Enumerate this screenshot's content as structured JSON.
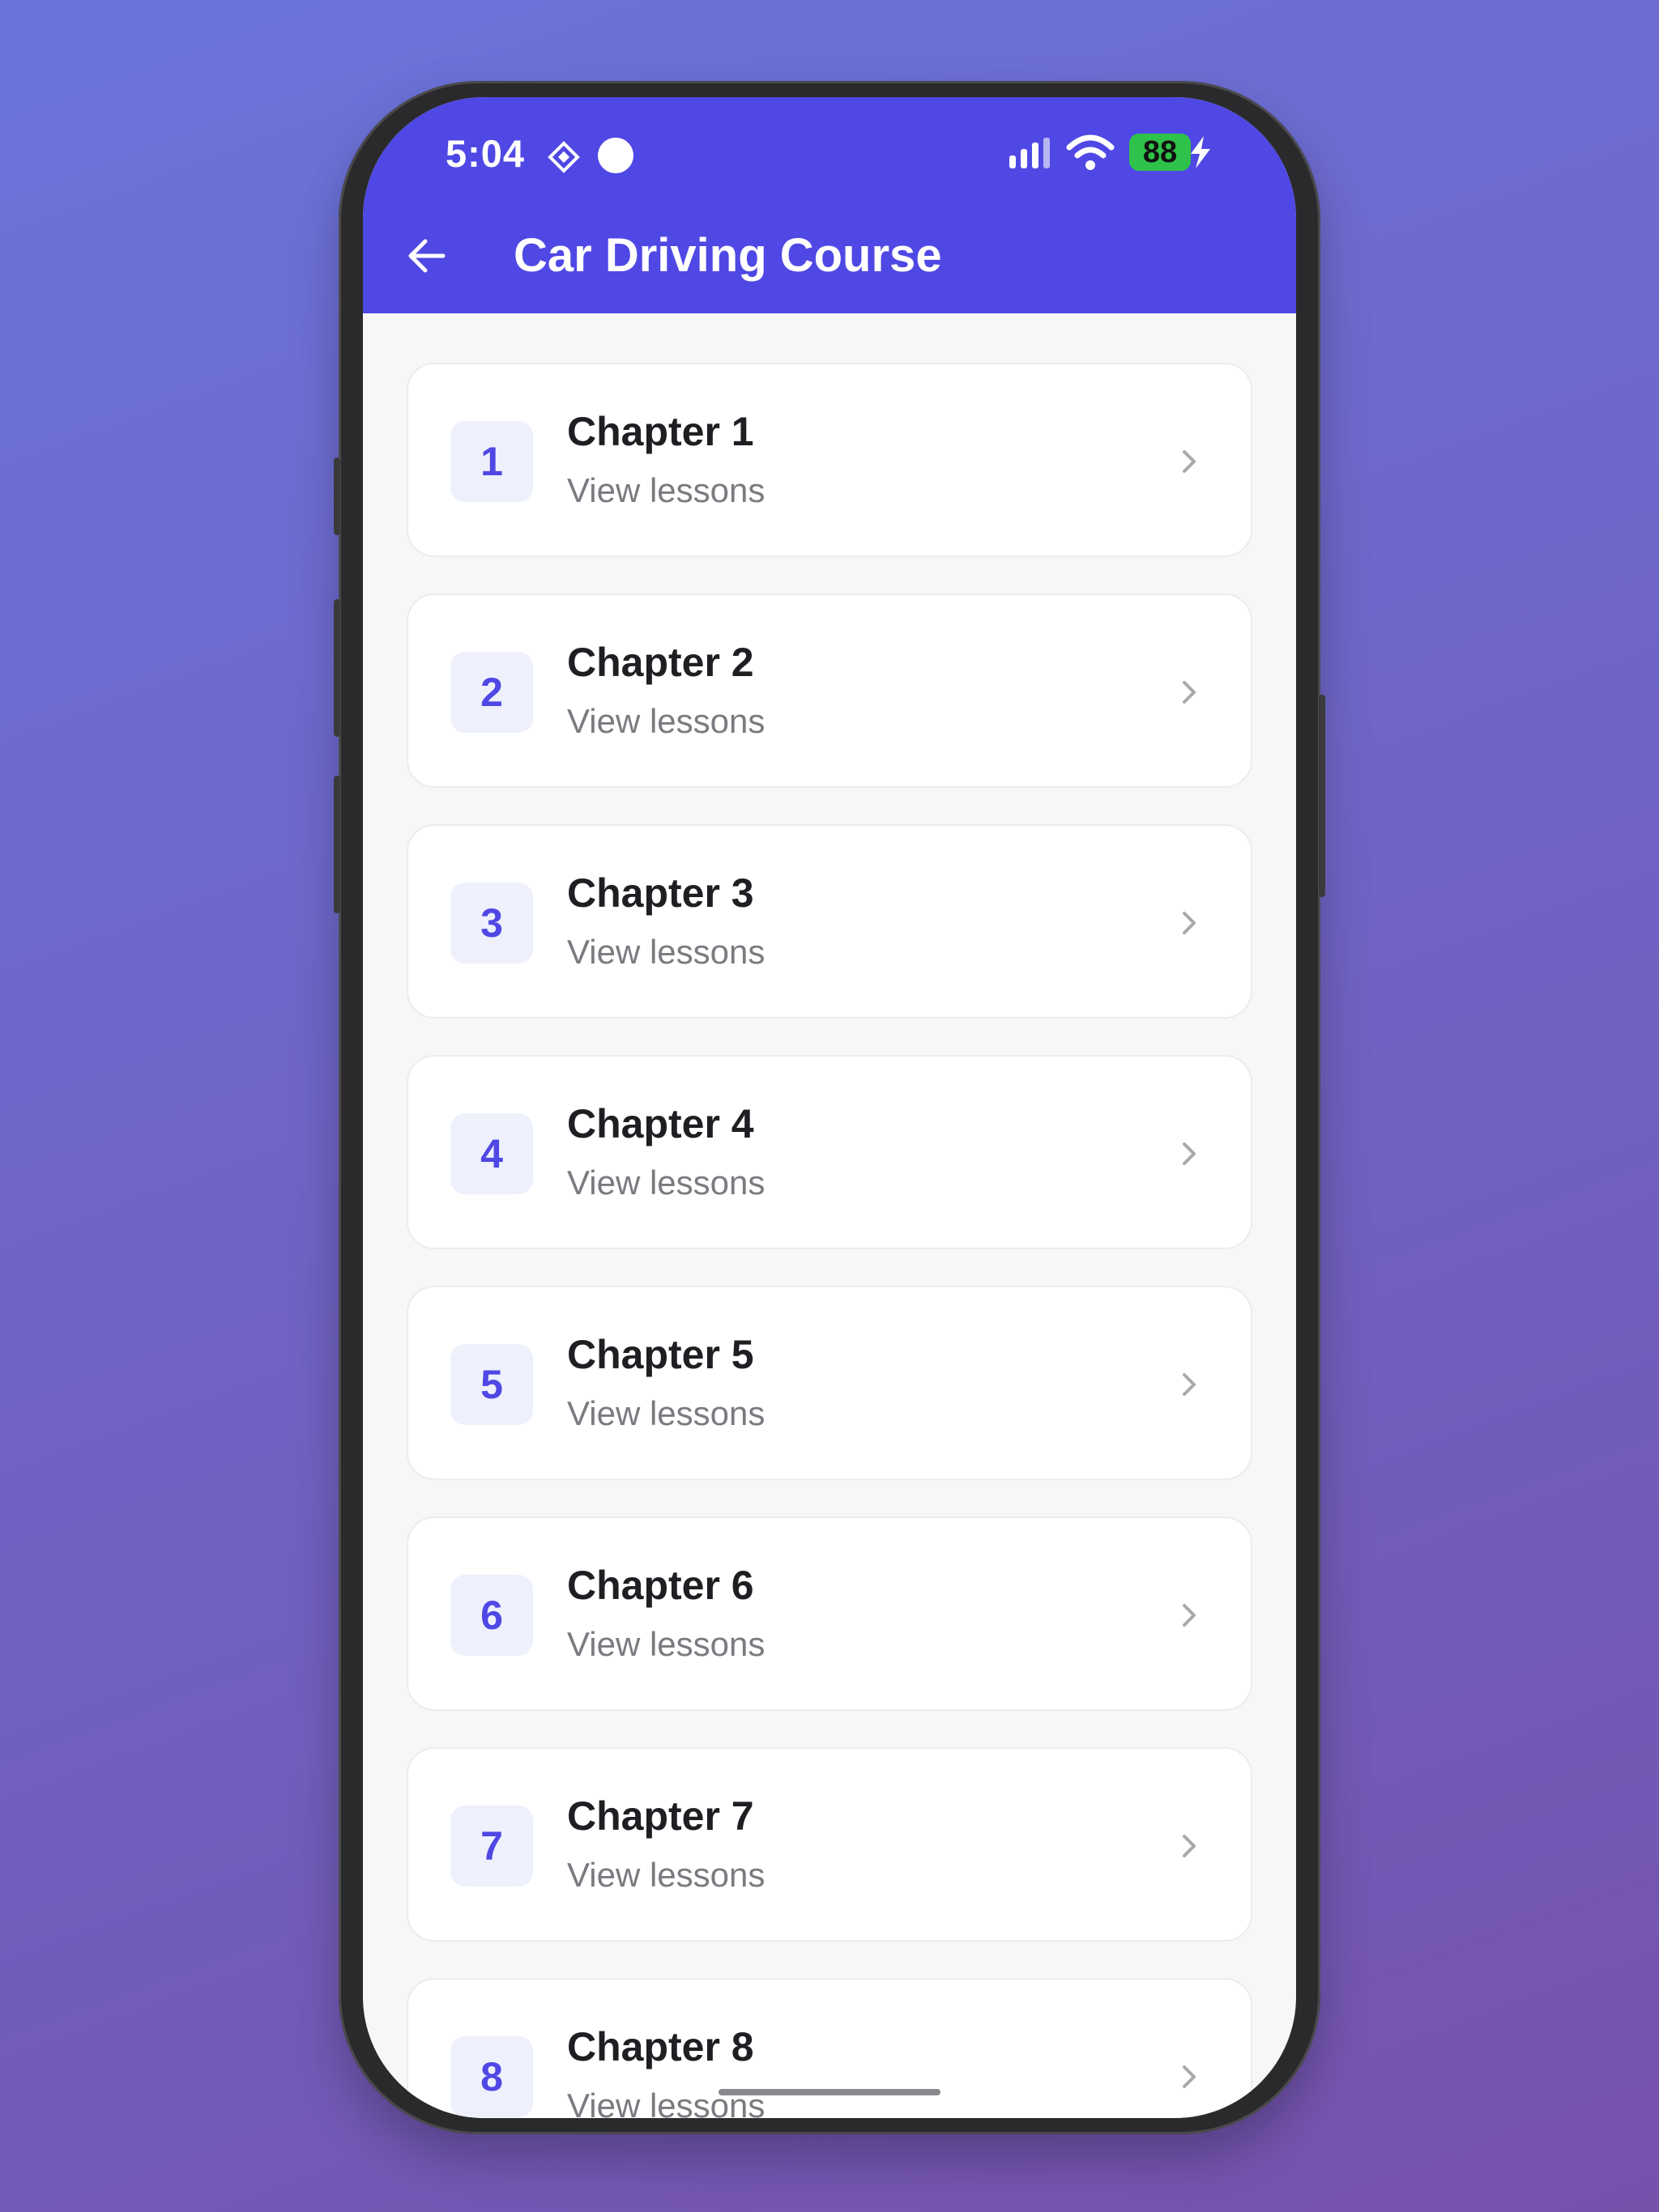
{
  "status_bar": {
    "time": "5:04",
    "battery": "88"
  },
  "app_bar": {
    "title": "Car Driving Course",
    "back_icon": "arrow-left-icon"
  },
  "colors": {
    "primary": "#4f48e4",
    "badge_bg": "#eef0fc",
    "battery": "#2fc24a"
  },
  "chapters": [
    {
      "number": "1",
      "title": "Chapter 1",
      "subtitle": "View lessons"
    },
    {
      "number": "2",
      "title": "Chapter 2",
      "subtitle": "View lessons"
    },
    {
      "number": "3",
      "title": "Chapter 3",
      "subtitle": "View lessons"
    },
    {
      "number": "4",
      "title": "Chapter 4",
      "subtitle": "View lessons"
    },
    {
      "number": "5",
      "title": "Chapter 5",
      "subtitle": "View lessons"
    },
    {
      "number": "6",
      "title": "Chapter 6",
      "subtitle": "View lessons"
    },
    {
      "number": "7",
      "title": "Chapter 7",
      "subtitle": "View lessons"
    },
    {
      "number": "8",
      "title": "Chapter 8",
      "subtitle": "View lessons"
    }
  ]
}
